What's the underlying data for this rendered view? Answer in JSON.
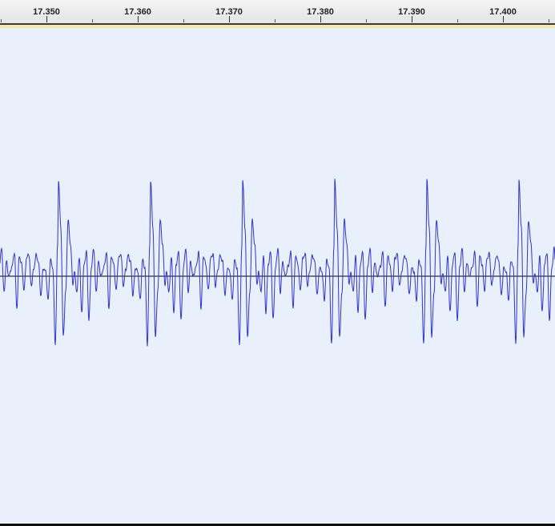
{
  "timeline": {
    "ticks": [
      "17.350",
      "17.360",
      "17.370",
      "17.380",
      "17.390",
      "17.400"
    ]
  },
  "track": {
    "waveform_color": "#3333cc",
    "background_color": "#e8f1fb",
    "zero_line_color": "#000000"
  }
}
